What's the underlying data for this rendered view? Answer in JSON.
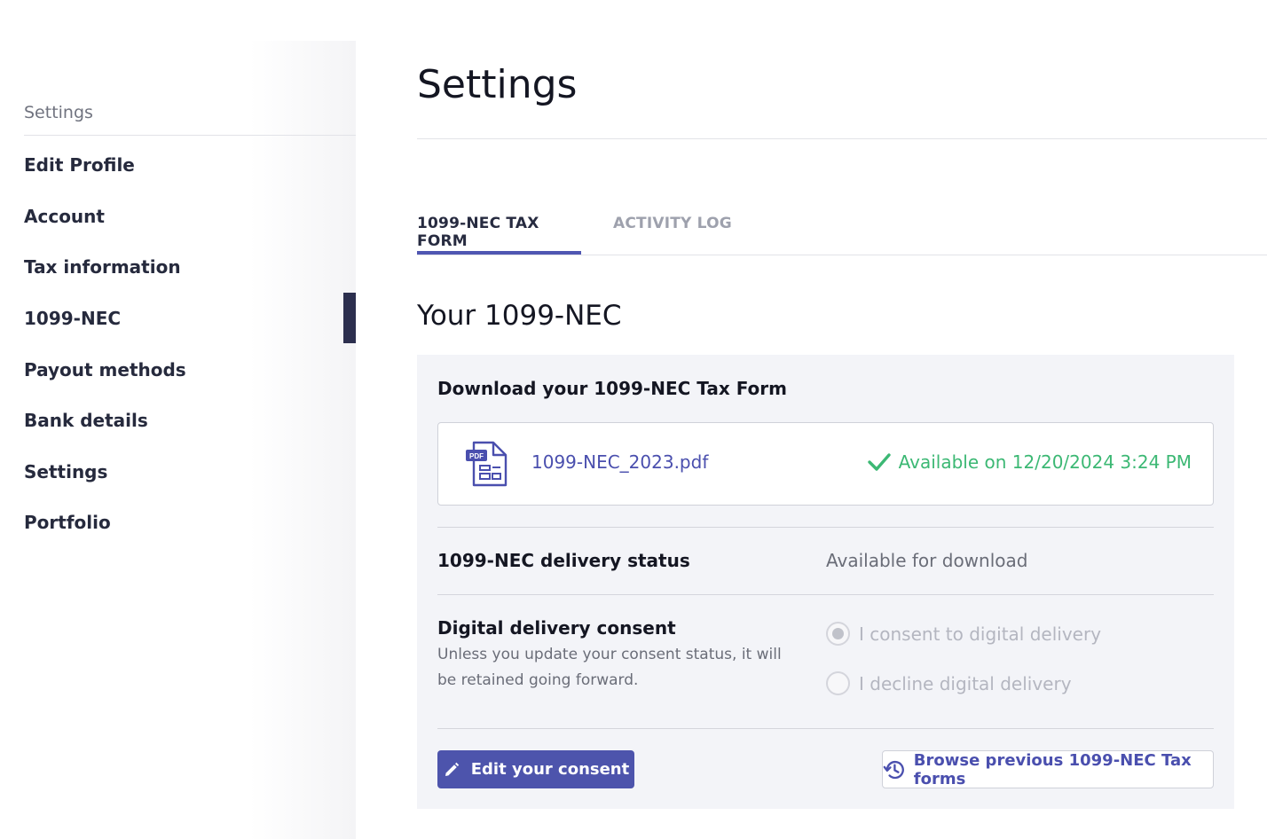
{
  "sidebar": {
    "header": "Settings",
    "items": [
      {
        "label": "Edit Profile"
      },
      {
        "label": "Account"
      },
      {
        "label": "Tax information"
      },
      {
        "label": "1099-NEC",
        "active": true
      },
      {
        "label": "Payout methods"
      },
      {
        "label": "Bank details"
      },
      {
        "label": "Settings"
      },
      {
        "label": "Portfolio"
      }
    ]
  },
  "page": {
    "title": "Settings"
  },
  "tabs": [
    {
      "label": "1099-NEC TAX FORM",
      "active": true
    },
    {
      "label": "ACTIVITY LOG",
      "active": false
    }
  ],
  "section": {
    "title": "Your 1099-NEC",
    "download_label": "Download your 1099-NEC Tax Form",
    "file": {
      "name": "1099-NEC_2023.pdf",
      "icon": "pdf-file-icon",
      "availability": "Available on 12/20/2024 3:24 PM"
    },
    "delivery_status": {
      "label": "1099-NEC delivery status",
      "value": "Available for download"
    },
    "consent": {
      "label": "Digital delivery consent",
      "help": "Unless you update your consent status, it will be retained going forward.",
      "options": [
        {
          "label": "I consent to digital delivery",
          "checked": true
        },
        {
          "label": "I decline digital delivery",
          "checked": false
        }
      ]
    },
    "edit_button": "Edit your consent",
    "browse_button": "Browse previous 1099-NEC Tax forms"
  },
  "colors": {
    "accent": "#4d54ac",
    "success": "#3cb874",
    "active_nav_bar": "#2c2f4e"
  }
}
